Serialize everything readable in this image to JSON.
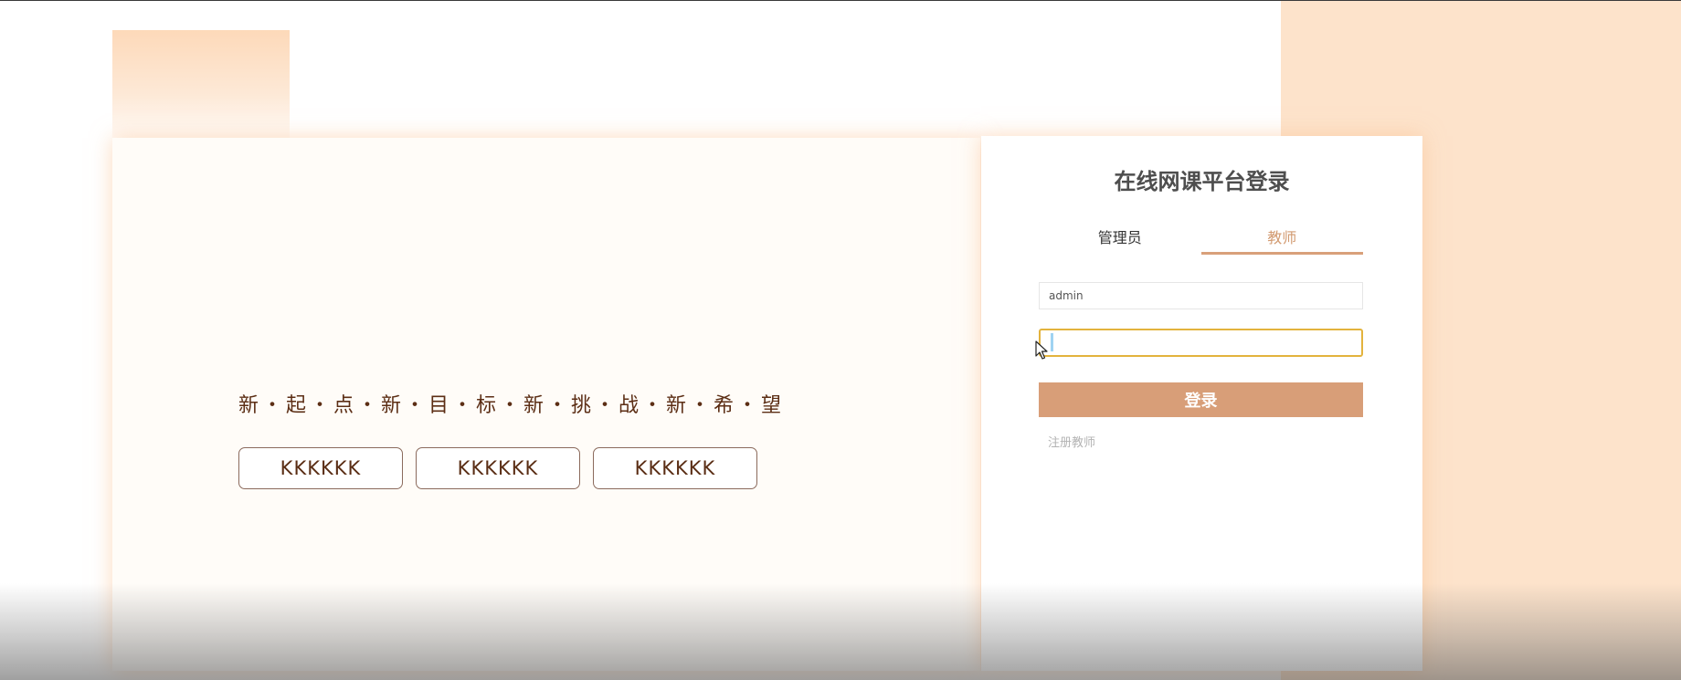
{
  "hero": {
    "slogan": "新・起・点・新・目・标・新・挑・战・新・希・望",
    "tags": [
      "KKKKKK",
      "KKKKKK",
      "KKKKKK"
    ]
  },
  "login": {
    "title": "在线网课平台登录",
    "tabs": [
      {
        "label": "管理员",
        "active": false
      },
      {
        "label": "教师",
        "active": true
      }
    ],
    "username": {
      "value": "admin",
      "placeholder": ""
    },
    "password": {
      "value": "",
      "placeholder": ""
    },
    "submit_label": "登录",
    "register_label": "注册教师"
  },
  "colors": {
    "accent": "#d89e78",
    "background_peach": "#fde3cb",
    "focus_border": "#e3b33d",
    "slogan_text": "#5c2e15"
  },
  "icons": {
    "cursor": "mouse-pointer-icon"
  }
}
